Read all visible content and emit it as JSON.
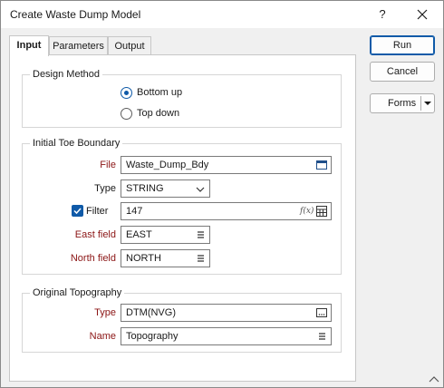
{
  "window": {
    "title": "Create Waste Dump Model",
    "help_label": "?"
  },
  "tabs": [
    {
      "label": "Input",
      "active": true
    },
    {
      "label": "Parameters",
      "active": false
    },
    {
      "label": "Output",
      "active": false
    }
  ],
  "design_method": {
    "title": "Design Method",
    "options": [
      {
        "label": "Bottom up",
        "selected": true
      },
      {
        "label": "Top down",
        "selected": false
      }
    ]
  },
  "initial_toe": {
    "title": "Initial Toe Boundary",
    "file": {
      "label": "File",
      "value": "Waste_Dump_Bdy"
    },
    "type": {
      "label": "Type",
      "value": "STRING"
    },
    "filter": {
      "label": "Filter",
      "value": "147",
      "checked": true
    },
    "east": {
      "label": "East field",
      "value": "EAST"
    },
    "north": {
      "label": "North field",
      "value": "NORTH"
    }
  },
  "original_topo": {
    "title": "Original Topography",
    "type": {
      "label": "Type",
      "value": "DTM(NVG)"
    },
    "name": {
      "label": "Name",
      "value": "Topography"
    }
  },
  "buttons": {
    "run": "Run",
    "cancel": "Cancel",
    "forms": "Forms"
  },
  "colors": {
    "accent": "#0f5aa8",
    "required_label": "#8b1414"
  }
}
